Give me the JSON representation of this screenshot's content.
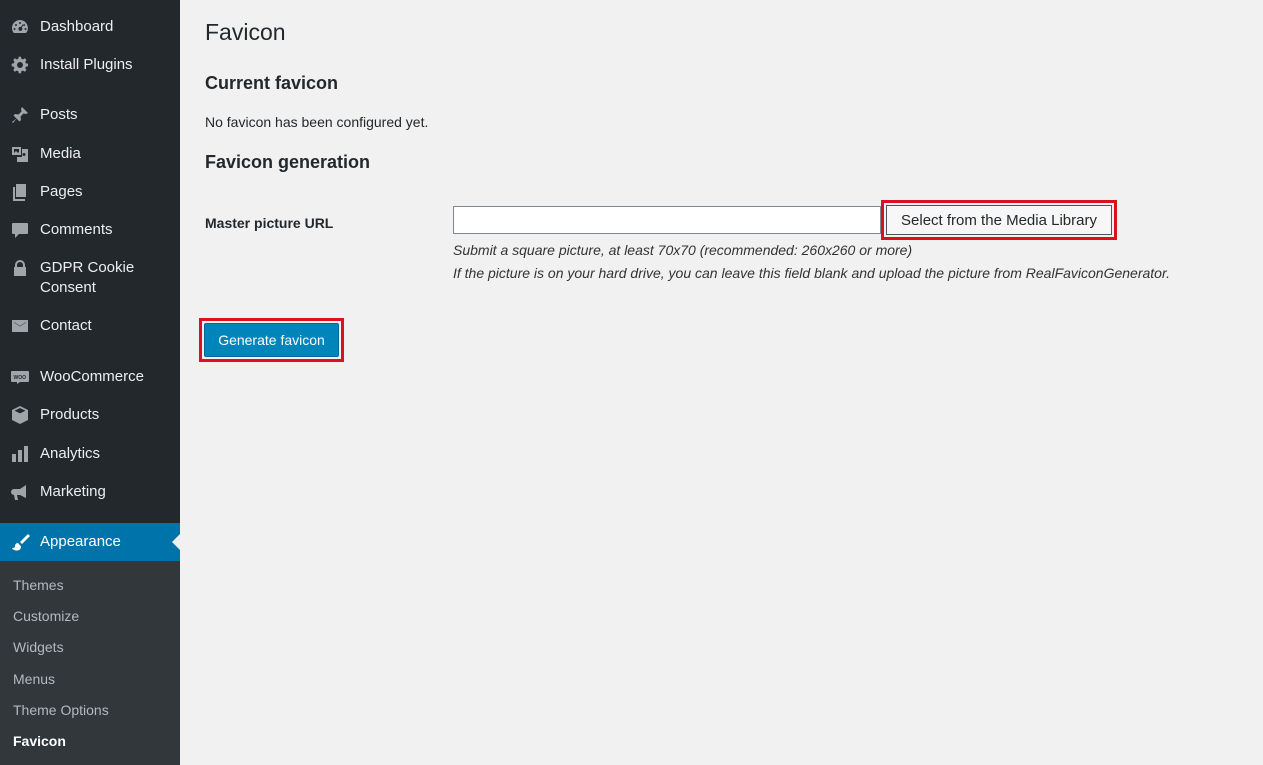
{
  "sidebar": {
    "items": [
      {
        "label": "Dashboard",
        "icon": "dashboard-icon"
      },
      {
        "label": "Install Plugins",
        "icon": "gear-icon"
      },
      {
        "label": "Posts",
        "icon": "pin-icon"
      },
      {
        "label": "Media",
        "icon": "media-icon"
      },
      {
        "label": "Pages",
        "icon": "pages-icon"
      },
      {
        "label": "Comments",
        "icon": "comment-icon"
      },
      {
        "label": "GDPR Cookie Consent",
        "icon": "lock-icon"
      },
      {
        "label": "Contact",
        "icon": "envelope-icon"
      },
      {
        "label": "WooCommerce",
        "icon": "woo-icon"
      },
      {
        "label": "Products",
        "icon": "box-icon"
      },
      {
        "label": "Analytics",
        "icon": "bar-chart-icon"
      },
      {
        "label": "Marketing",
        "icon": "megaphone-icon"
      },
      {
        "label": "Appearance",
        "icon": "paintbrush-icon"
      }
    ],
    "submenu": [
      "Themes",
      "Customize",
      "Widgets",
      "Menus",
      "Theme Options",
      "Favicon"
    ]
  },
  "main": {
    "title": "Favicon",
    "current_heading": "Current favicon",
    "current_text": "No favicon has been configured yet.",
    "generation_heading": "Favicon generation",
    "field_label": "Master picture URL",
    "url_value": "",
    "media_button": "Select from the Media Library",
    "desc_line1": "Submit a square picture, at least 70x70 (recommended: 260x260 or more)",
    "desc_line2": "If the picture is on your hard drive, you can leave this field blank and upload the picture from RealFaviconGenerator.",
    "generate_button": "Generate favicon"
  },
  "colors": {
    "sidebar_bg": "#23282d",
    "submenu_bg": "#32373c",
    "active_bg": "#0073aa",
    "primary_button": "#0085ba",
    "highlight_border": "#dd1020",
    "content_bg": "#f1f1f1"
  }
}
